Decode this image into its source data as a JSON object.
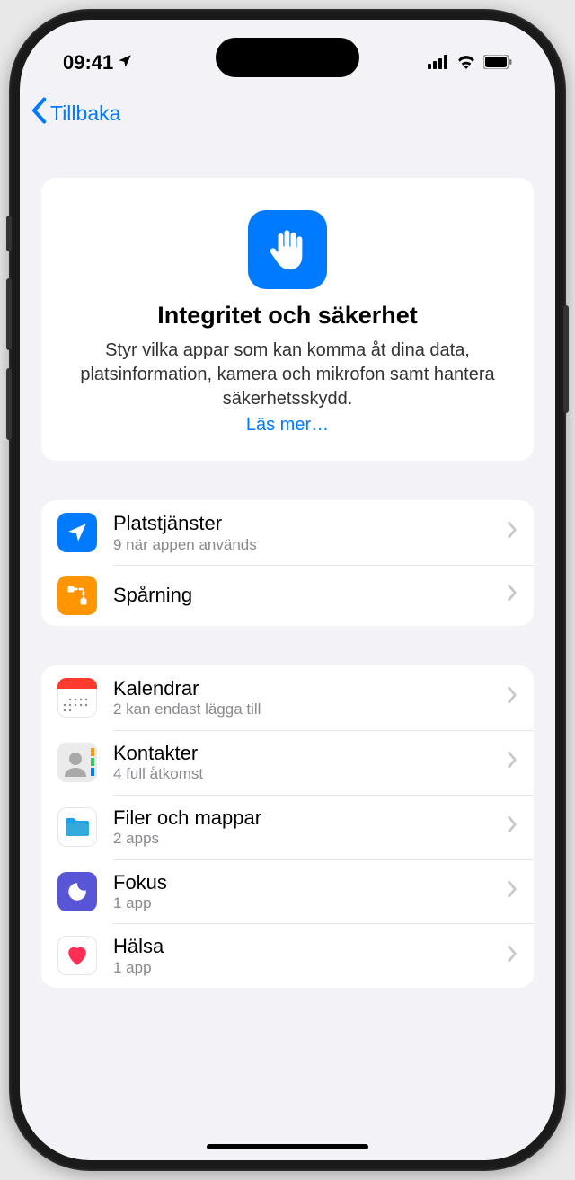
{
  "status": {
    "time": "09:41",
    "location_active": true
  },
  "nav": {
    "back_label": "Tillbaka"
  },
  "hero": {
    "title": "Integritet och säkerhet",
    "description": "Styr vilka appar som kan komma åt dina data, platsinformation, kamera och mikrofon samt hantera säkerhetsskydd.",
    "learn_more": "Läs mer…"
  },
  "group1": {
    "items": [
      {
        "icon": "location",
        "title": "Platstjänster",
        "subtitle": "9 när appen används"
      },
      {
        "icon": "tracking",
        "title": "Spårning",
        "subtitle": ""
      }
    ]
  },
  "group2": {
    "items": [
      {
        "icon": "calendar",
        "title": "Kalendrar",
        "subtitle": "2 kan endast lägga till"
      },
      {
        "icon": "contacts",
        "title": "Kontakter",
        "subtitle": "4 full åtkomst"
      },
      {
        "icon": "files",
        "title": "Filer och mappar",
        "subtitle": "2 apps"
      },
      {
        "icon": "focus",
        "title": "Fokus",
        "subtitle": "1 app"
      },
      {
        "icon": "health",
        "title": "Hälsa",
        "subtitle": "1 app"
      }
    ]
  }
}
